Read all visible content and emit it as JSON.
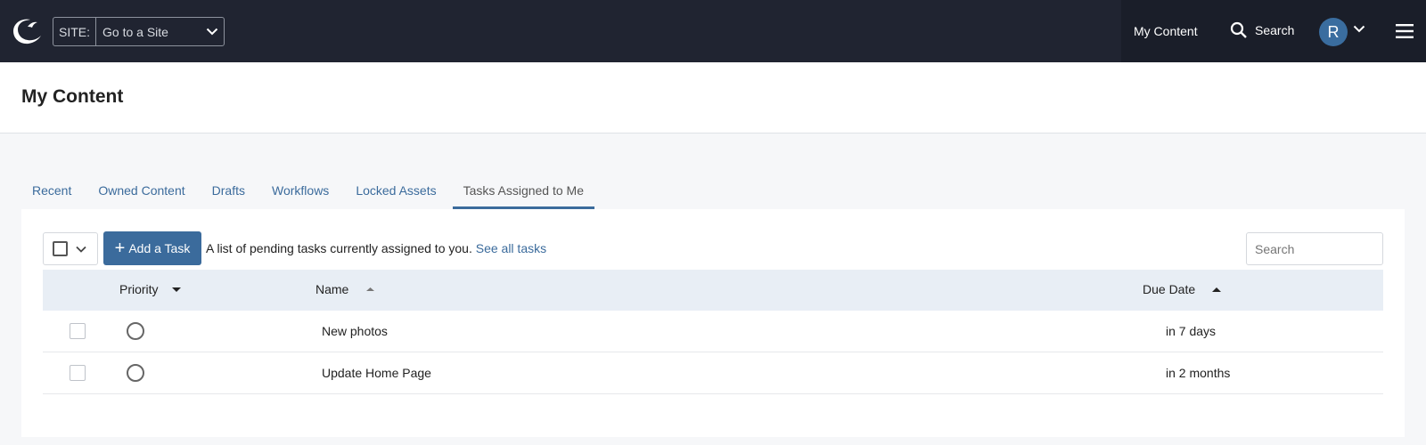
{
  "topnav": {
    "site_label": "SITE:",
    "site_value": "Go to a Site",
    "my_content": "My Content",
    "search": "Search",
    "avatar_initial": "R"
  },
  "page": {
    "title": "My Content"
  },
  "tabs": [
    {
      "label": "Recent",
      "active": false
    },
    {
      "label": "Owned Content",
      "active": false
    },
    {
      "label": "Drafts",
      "active": false
    },
    {
      "label": "Workflows",
      "active": false
    },
    {
      "label": "Locked Assets",
      "active": false
    },
    {
      "label": "Tasks Assigned to Me",
      "active": true
    }
  ],
  "toolbar": {
    "add_task": "Add a Task",
    "helper_text": "A list of pending tasks currently assigned to you.",
    "see_all": "See all tasks",
    "search_placeholder": "Search"
  },
  "table": {
    "columns": {
      "priority": "Priority",
      "name": "Name",
      "due": "Due Date"
    },
    "rows": [
      {
        "name": "New photos",
        "due": "in 7 days"
      },
      {
        "name": "Update Home Page",
        "due": "in 2 months"
      }
    ]
  },
  "colors": {
    "nav_bg": "#202431",
    "accent": "#3b6b9c",
    "table_header_bg": "#e8eef5"
  }
}
